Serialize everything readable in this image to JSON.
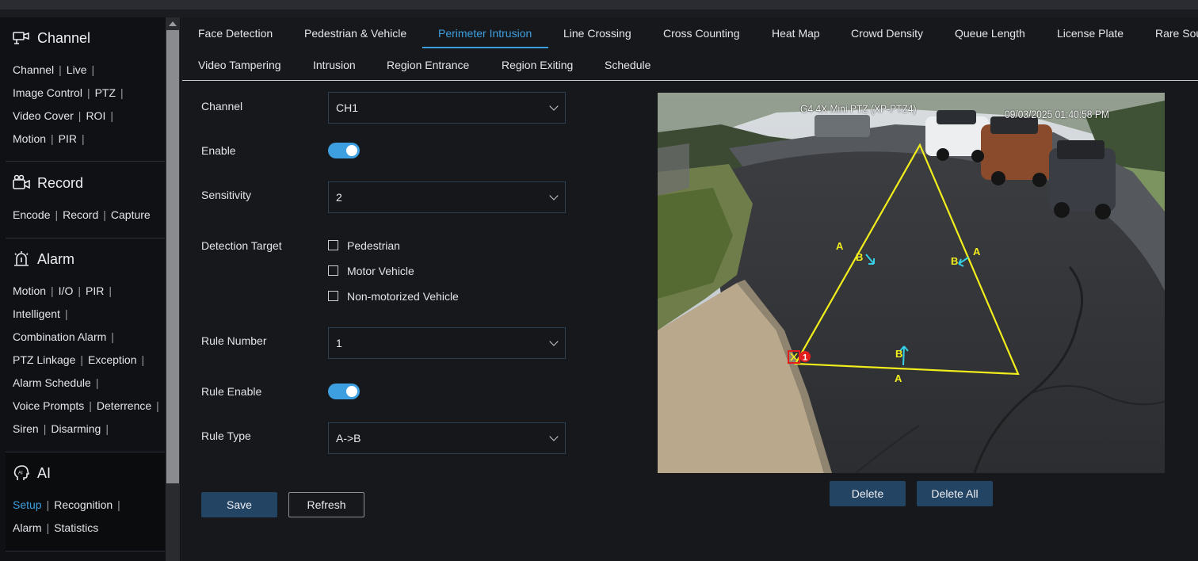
{
  "sidebar": {
    "sections": [
      {
        "title": "Channel",
        "icon": "channel-camera-icon",
        "rows": [
          [
            "Channel",
            "Live"
          ],
          [
            "Image Control",
            "PTZ"
          ],
          [
            "Video Cover",
            "ROI"
          ],
          [
            "Motion",
            "PIR"
          ]
        ]
      },
      {
        "title": "Record",
        "icon": "record-camera-icon",
        "rows": [
          [
            "Encode",
            "Record",
            "Capture"
          ]
        ]
      },
      {
        "title": "Alarm",
        "icon": "alarm-siren-icon",
        "rows": [
          [
            "Motion",
            "I/O",
            "PIR"
          ],
          [
            "Intelligent"
          ],
          [
            "Combination Alarm"
          ],
          [
            "PTZ Linkage",
            "Exception"
          ],
          [
            "Alarm Schedule"
          ],
          [
            "Voice Prompts",
            "Deterrence"
          ],
          [
            "Siren",
            "Disarming"
          ]
        ]
      },
      {
        "title": "AI",
        "icon": "ai-head-icon",
        "rows": [
          [
            "Setup",
            "Recognition"
          ],
          [
            "Alarm",
            "Statistics"
          ]
        ]
      }
    ]
  },
  "tabs": {
    "row1": [
      "Face Detection",
      "Pedestrian & Vehicle",
      "Perimeter Intrusion",
      "Line Crossing",
      "Cross Counting",
      "Heat Map",
      "Crowd Density",
      "Queue Length",
      "License Plate",
      "Rare Sou"
    ],
    "row2": [
      "Video Tampering",
      "Intrusion",
      "Region Entrance",
      "Region Exiting",
      "Schedule"
    ],
    "active": "Perimeter Intrusion"
  },
  "form": {
    "channel_label": "Channel",
    "channel_value": "CH1",
    "enable_label": "Enable",
    "enable_on": true,
    "sensitivity_label": "Sensitivity",
    "sensitivity_value": "2",
    "detection_target_label": "Detection Target",
    "targets": [
      "Pedestrian",
      "Motor Vehicle",
      "Non-motorized Vehicle"
    ],
    "rule_number_label": "Rule Number",
    "rule_number_value": "1",
    "rule_enable_label": "Rule Enable",
    "rule_enable_on": true,
    "rule_type_label": "Rule Type",
    "rule_type_value": "A->B",
    "save_label": "Save",
    "refresh_label": "Refresh"
  },
  "video": {
    "camera_title": "G4 4X Mini PTZ (XP-PTZ4)",
    "timestamp": "09/03/2025 01:40:58 PM",
    "rule_badge": "1",
    "side_labels": [
      "A",
      "B",
      "B",
      "A",
      "B",
      "A"
    ],
    "delete_label": "Delete",
    "delete_all_label": "Delete All"
  },
  "colors": {
    "accent": "#3d9fe0",
    "button": "#244464",
    "zone_line": "#f2ee1c",
    "direction_arrow": "#35d0e6"
  }
}
